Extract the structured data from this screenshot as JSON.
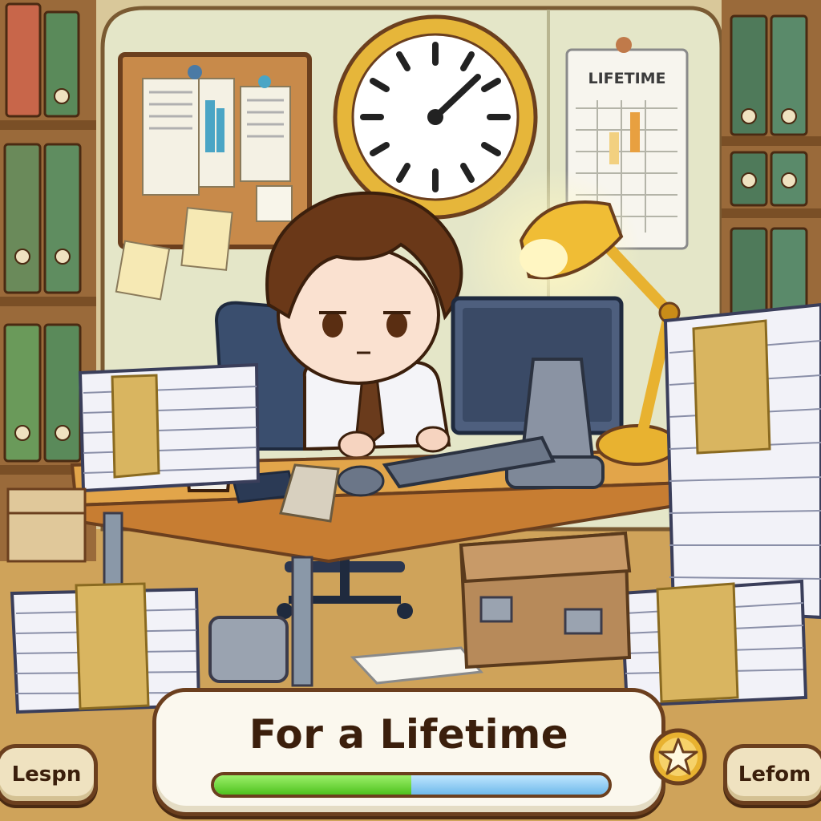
{
  "scene": {
    "wall_chart_label": "LIFETIME",
    "clock_hand_minute": 8,
    "clock_hand_hour": 12
  },
  "hud": {
    "title": "For a Lifetime",
    "progress_green_fraction": 0.5,
    "progress_blue_fraction": 0.5
  },
  "buttons": {
    "left_label": "Lespn",
    "right_label": "Lefom",
    "star_icon": "star-icon"
  },
  "colors": {
    "wall": "#e4e6c8",
    "desk": "#e2a54a",
    "progress_green": "#4fc11f",
    "progress_blue": "#6fb9ea",
    "frame_brown": "#6b3f1e"
  }
}
